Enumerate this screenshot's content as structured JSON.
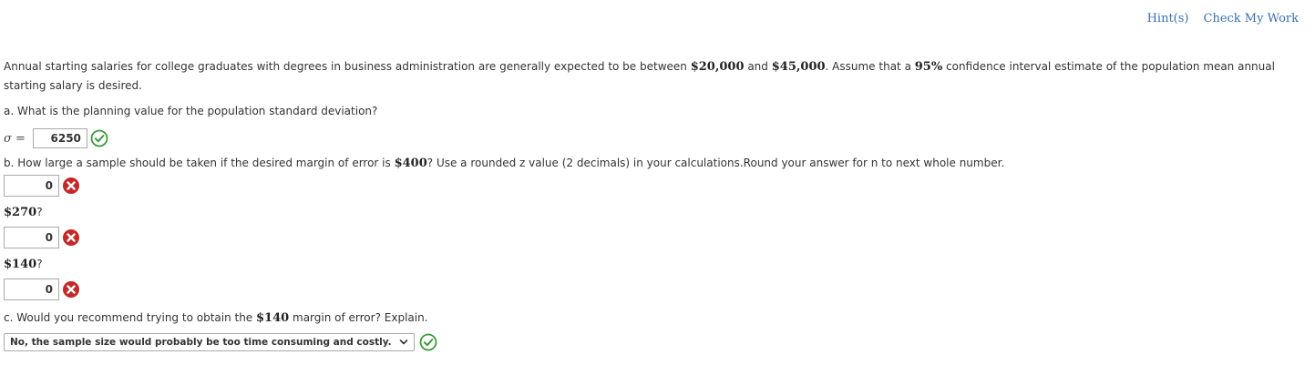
{
  "toplinks": {
    "hints": "Hint(s)",
    "check": "Check My Work"
  },
  "intro": {
    "t1": "Annual starting salaries for college graduates with degrees in business administration are generally expected to be between ",
    "low": "$20,000",
    "t2": " and ",
    "high": "$45,000",
    "t3": ". Assume that a ",
    "conf": "95%",
    "t4": " confidence interval estimate of the population mean annual starting salary is desired."
  },
  "qa": {
    "text": "a. What is the planning value for the population standard deviation?",
    "sigma_label": "σ",
    "eq": " =",
    "value": "6250",
    "status": "check-icon"
  },
  "qb": {
    "t1": "b. How large a sample should be taken if the desired margin of error is ",
    "margin": "$400",
    "t2": "? Use a rounded z value (2 decimals) in your calculations.Round your answer for n to next whole number.",
    "answers": [
      {
        "margin_label": "",
        "value": "0",
        "status": "x-icon"
      },
      {
        "margin_label": "$270",
        "suffix": "?",
        "value": "0",
        "status": "x-icon"
      },
      {
        "margin_label": "$140",
        "suffix": "?",
        "value": "0",
        "status": "x-icon"
      }
    ]
  },
  "qc": {
    "t1": "c. Would you recommend trying to obtain the ",
    "margin": "$140",
    "t2": " margin of error? Explain.",
    "selected": "No, the sample size would probably be too time consuming and costly.",
    "status": "check-icon"
  },
  "colors": {
    "link": "#3a6fb0",
    "check": "#3a9a3a",
    "x": "#c62828"
  }
}
